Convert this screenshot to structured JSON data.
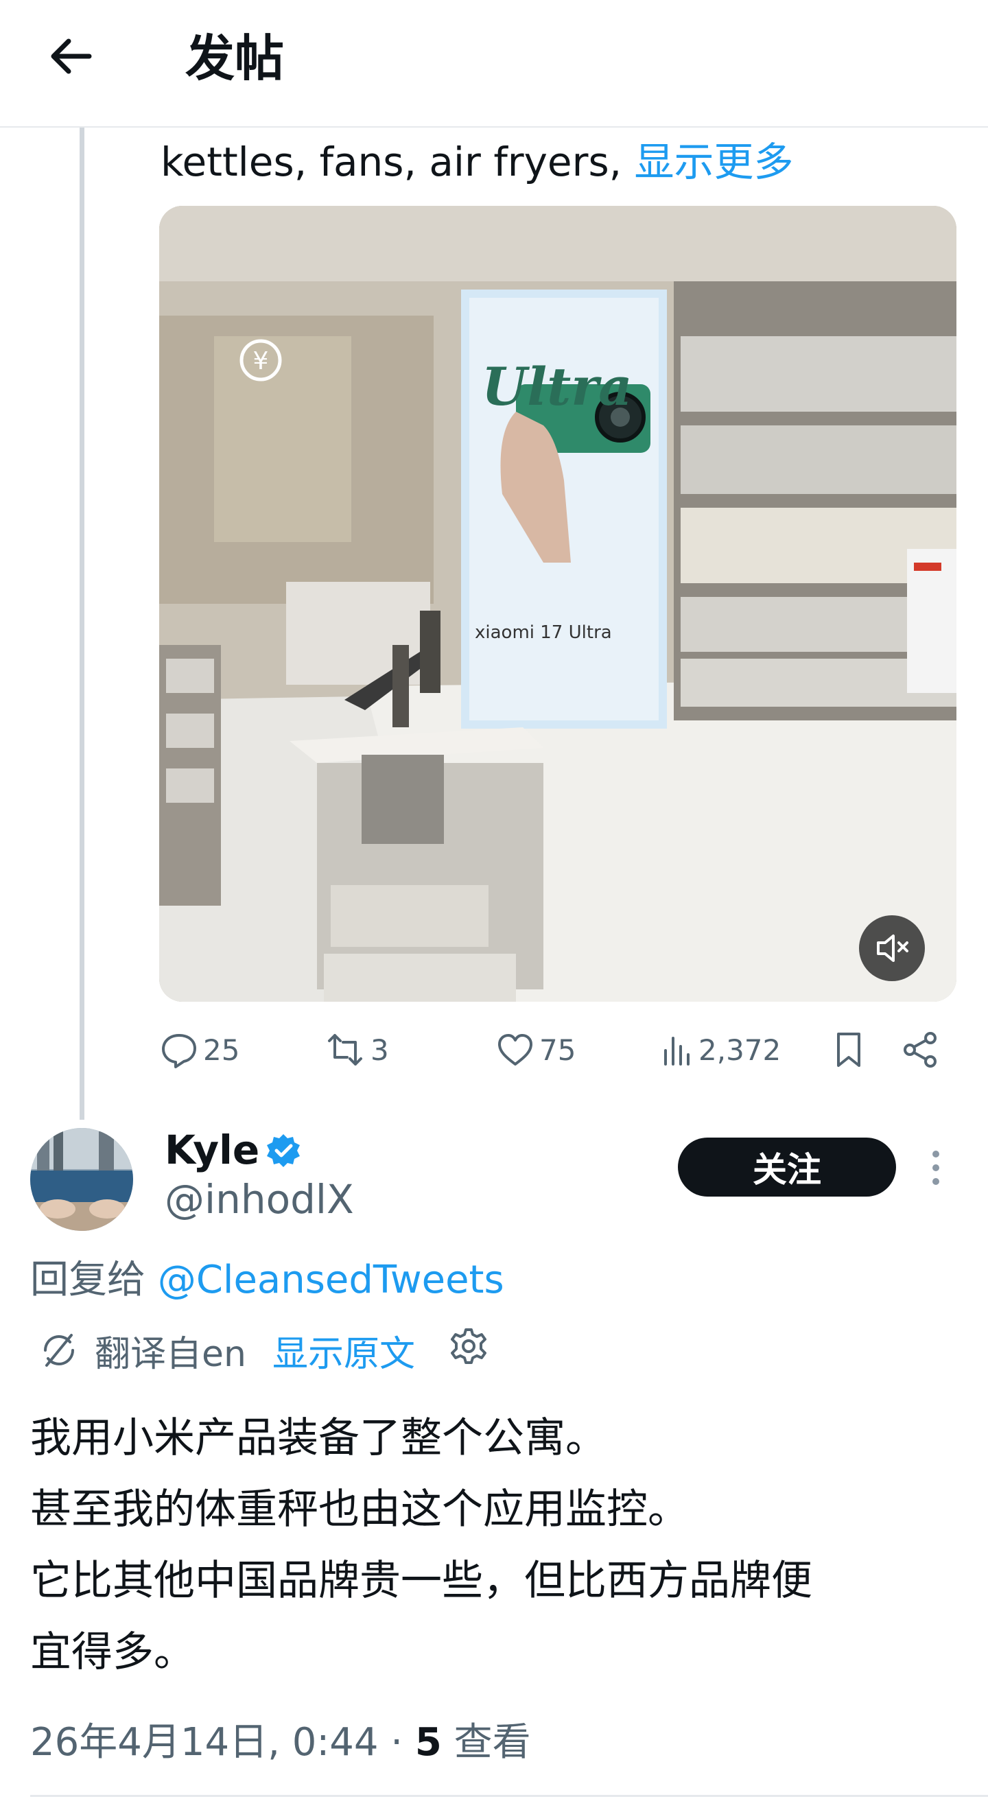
{
  "header": {
    "title": "发帖",
    "back_icon": "arrow-left-icon"
  },
  "quoted_post": {
    "text": "kettles, fans, air fryers, ",
    "show_more": "显示更多",
    "media": {
      "type": "video",
      "poster_lines": [
        "Ultra",
        "xiaomi 17 Ultra"
      ],
      "mute_icon": "speaker-muted-icon"
    },
    "actions": {
      "replies": "25",
      "reposts": "3",
      "likes": "75",
      "views": "2,372"
    }
  },
  "reply_post": {
    "display_name": "Kyle",
    "verified": true,
    "handle": "@inhodlX",
    "follow_label": "关注",
    "reply_to_prefix": "回复给 ",
    "reply_to_handle": "@CleansedTweets",
    "translation": {
      "label": "翻译自en",
      "show_original": "显示原文"
    },
    "body_lines": [
      "我用小米产品装备了整个公寓。",
      "甚至我的体重秤也由这个应用监控。",
      "它比其他中国品牌贵一些，但比西方品牌便",
      "宜得多。"
    ],
    "timestamp": "26年4月14日, 0:44 · ",
    "view_count": "5",
    "views_label": " 查看"
  },
  "colors": {
    "accent": "#1d9bf0",
    "text": "#0f1419",
    "muted": "#536471"
  }
}
